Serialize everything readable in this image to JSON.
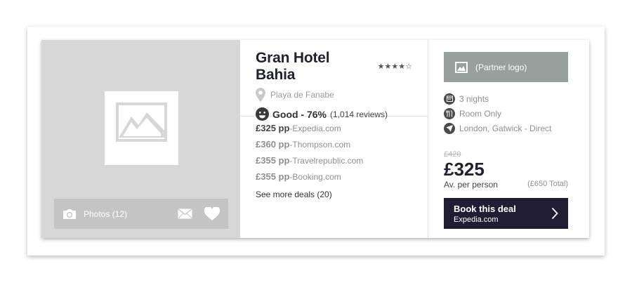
{
  "hotel": {
    "name": "Gran Hotel Bahia",
    "stars": [
      "★",
      "★",
      "★",
      "★",
      "☆"
    ],
    "location": "Playa de Fanabe",
    "rating": "Good - 76%",
    "reviews": "(1,014 reviews)"
  },
  "photos": {
    "label": "Photos (12)"
  },
  "deals": [
    {
      "price": "£325 pp",
      "sep": " - ",
      "provider": "Expedia.com"
    },
    {
      "price": "£360 pp",
      "sep": " - ",
      "provider": "Thompson.com"
    },
    {
      "price": "£355 pp",
      "sep": " - ",
      "provider": "Travelrepublic.com"
    },
    {
      "price": "£355 pp",
      "sep": " - ",
      "provider": "Booking.com"
    }
  ],
  "see_more": "See more deals (20)",
  "booking": {
    "partner_logo": "(Partner logo)",
    "facts": [
      {
        "icon": "calendar-icon",
        "text": "3 nights"
      },
      {
        "icon": "cutlery-icon",
        "text": "Room Only"
      },
      {
        "icon": "plane-icon",
        "text": "London, Gatwick - Direct"
      }
    ],
    "old_price": "£420",
    "price": "£325",
    "per_person": "Av. per person",
    "total": "(£650 Total)",
    "button_title": "Book this deal",
    "button_sub": "Expedia.com"
  },
  "colors": {
    "button": "#211e33",
    "partner": "#97a09c",
    "photo_bg": "#d7d7d7"
  }
}
